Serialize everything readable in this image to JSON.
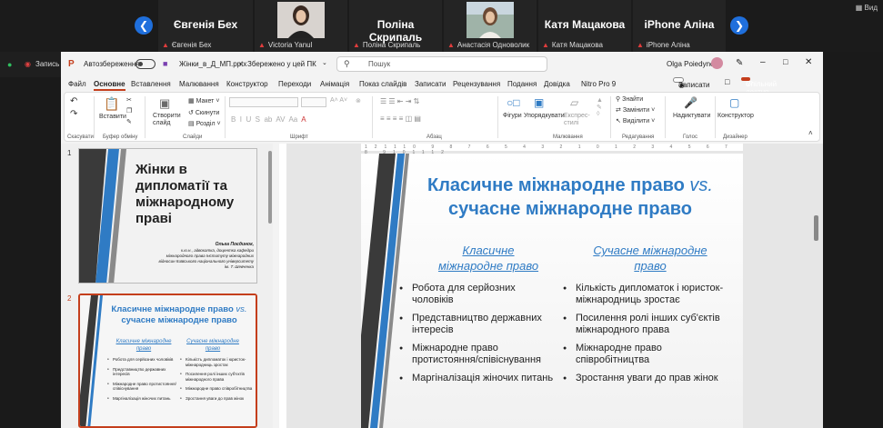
{
  "zoom": {
    "view_label": "Вид",
    "record_label": "Запись",
    "participants": [
      {
        "name": "Євгенія Бех",
        "label": "Євгенія Бех"
      },
      {
        "name": "",
        "label": "Victoria Yanul"
      },
      {
        "name": "Поліна Скрипаль",
        "label": "Поліна Скрипаль"
      },
      {
        "name": "",
        "label": "Анастасія Одноволик"
      },
      {
        "name": "Катя Мацакова",
        "label": "Катя Мацакова"
      },
      {
        "name": "iPhone Аліна",
        "label": "iPhone Аліна"
      }
    ]
  },
  "ppt": {
    "autosave_label": "Автозбереження",
    "file_name": "Жінки_в_Д_МП.pptx",
    "save_status": "Збережено у цей ПК",
    "search_placeholder": "Пошук",
    "user": "Olga Poiedynok",
    "menu": [
      "Файл",
      "Основне",
      "Вставлення",
      "Малювання",
      "Конструктор",
      "Переходи",
      "Анімація",
      "Показ слайдів",
      "Записати",
      "Рецензування",
      "Подання",
      "Довідка",
      "Nitro Pro 9"
    ],
    "record_btn": "Записати",
    "share_btn": "Спільний доступ",
    "ribbon": {
      "undo_group": "Скасувати",
      "clipboard_group": "Буфер обміну",
      "paste": "Вставити",
      "new_slide": "Створити слайд",
      "layout": "Макет",
      "reset": "Скинути",
      "sections": "Розділ",
      "slides_group": "Слайди",
      "font_group": "Шрифт",
      "para_group": "Абзац",
      "shapes": "Фігури",
      "arrange": "Упорядкувати",
      "quick_styles": "Експрес-стилі",
      "drawing_group": "Малювання",
      "find": "Знайти",
      "replace": "Замінити",
      "select": "Виділити",
      "editing_group": "Редагування",
      "dictate": "Надиктувати",
      "voice_group": "Голос",
      "designer": "Конструктор",
      "designer_group": "Дизайнер"
    }
  },
  "thumbs": {
    "s1_num": "1",
    "s1_title": "Жінки в дипломатії та міжнародному праві",
    "s1_author": "Ольга Поєдинок,",
    "s1_meta": "к.ю.н., адвокатка, доцентка кафедри міжнародного права Інституту міжнародних відносин Київського національного університету ім. Т. Шевченка",
    "s2_num": "2"
  },
  "slide": {
    "title_main": "Класичне міжнародне право ",
    "title_vs": "vs.",
    "title_line2": "сучасне міжнародне право",
    "left_head": "Класичне міжнародне право",
    "right_head": "Сучасне міжнародне право",
    "left_items": [
      "Робота для серйозних чоловіків",
      "Представництво державних інтересів",
      "Міжнародне право протистояння/співіснування",
      "Маргіналізація жіночих питань"
    ],
    "right_items": [
      "Кількість дипломаток і юристок-міжнародниць зростає",
      "Посилення ролі інших суб'єктів міжнародного права",
      "Міжнародне право співробітництва",
      "Зростання уваги до прав жінок"
    ]
  },
  "colors": {
    "accent": "#2f7bc4",
    "share": "#c43e1c",
    "zoom_nav": "#1f6fdc"
  }
}
